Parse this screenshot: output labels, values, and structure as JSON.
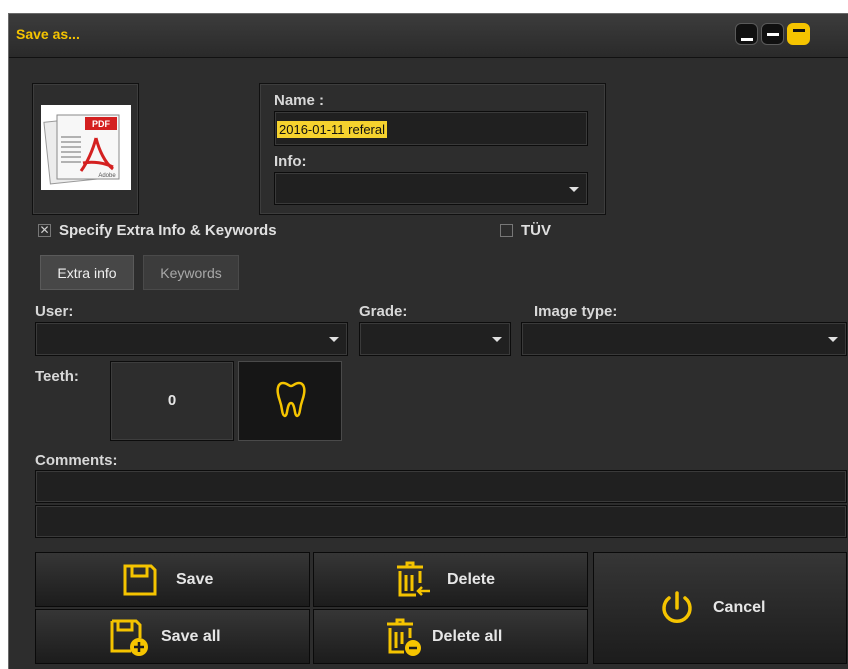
{
  "window": {
    "title": "Save as..."
  },
  "document": {
    "thumbnail_icon": "pdf-file-icon",
    "name_label": "Name :",
    "name_value": "2016-01-11  referal",
    "info_label": "Info:",
    "info_value": ""
  },
  "options": {
    "extra_info_checkbox_label": "Specify Extra Info & Keywords",
    "extra_info_checked": true,
    "tuv_label": "TÜV",
    "tuv_checked": false
  },
  "tabs": [
    {
      "label": "Extra info",
      "active": true
    },
    {
      "label": "Keywords",
      "active": false
    }
  ],
  "fields": {
    "user_label": "User:",
    "user_value": "",
    "grade_label": "Grade:",
    "grade_value": "",
    "image_type_label": "Image type:",
    "image_type_value": "",
    "teeth_label": "Teeth:",
    "teeth_count": "0",
    "comments_label": "Comments:",
    "comment_line_1": "",
    "comment_line_2": ""
  },
  "buttons": {
    "save": "Save",
    "save_all": "Save all",
    "delete": "Delete",
    "delete_all": "Delete all",
    "cancel": "Cancel"
  },
  "colors": {
    "accent": "#f5c400",
    "background": "#2d2d2d",
    "highlight_text_bg": "#f5d22e"
  }
}
